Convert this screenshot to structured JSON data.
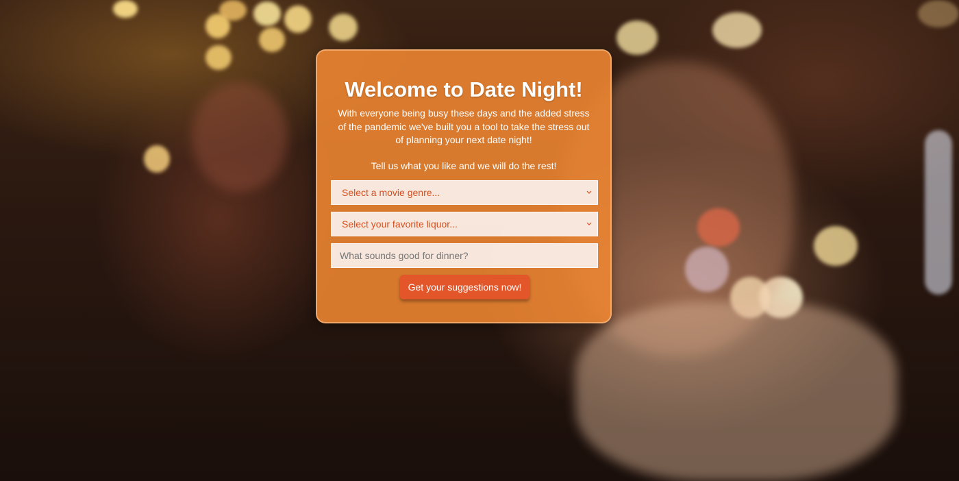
{
  "form": {
    "title": "Welcome to Date Night!",
    "intro": "With everyone being busy these days and the added stress of the pandemic we've built you a tool to take the stress out of planning your next date night!",
    "prompt": "Tell us what you like and we will do the rest!",
    "movie_select": {
      "value": "Select a movie genre...",
      "icon": "chevron-down-icon"
    },
    "liquor_select": {
      "value": "Select your favorite liquor...",
      "icon": "chevron-down-icon"
    },
    "dinner_input": {
      "placeholder": "What sounds good for dinner?",
      "value": ""
    },
    "submit_label": "Get your suggestions now!"
  },
  "colors": {
    "card_bg": "#f08732",
    "button_bg": "#e2562a",
    "select_text": "#d5501f",
    "title_text": "#ffffff"
  }
}
